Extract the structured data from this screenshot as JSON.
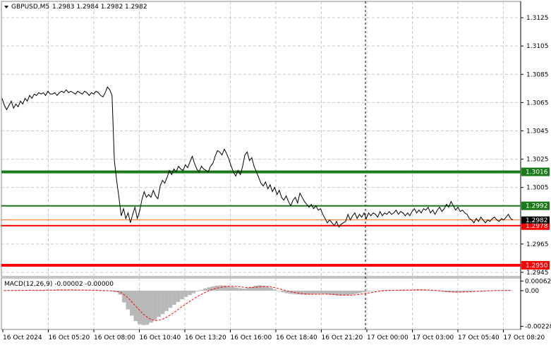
{
  "header": {
    "symbol_label": "GBPUSD,M5",
    "ohlc": "1.2983 1.2984 1.2982 1.2982"
  },
  "macd_label": "MACD(12,26,9) -0.00002 -0.00000",
  "colors": {
    "price_line": "#000000",
    "grid": "#c8c8c8",
    "level_green": "#1a7a1a",
    "level_red": "#ff0000",
    "current_price": "#ff6600",
    "macd_hist": "#b8b8b8",
    "macd_signal": "#ff0000",
    "tag_dark": "#000000"
  },
  "chart_data": {
    "type": "line",
    "title": "GBPUSD,M5",
    "y_ticks": [
      "1.3125",
      "1.3105",
      "1.3085",
      "1.3065",
      "1.3045",
      "1.3025",
      "1.3005",
      "1.2965",
      "1.2945"
    ],
    "ylim": [
      1.29425,
      1.3136
    ],
    "x_ticks": [
      "16 Oct 2024",
      "16 Oct 05:20",
      "16 Oct 08:00",
      "16 Oct 10:40",
      "16 Oct 13:20",
      "16 Oct 16:00",
      "16 Oct 18:40",
      "16 Oct 21:20",
      "17 Oct 00:00",
      "17 Oct 03:00",
      "17 Oct 05:40",
      "17 Oct 08:20"
    ],
    "levels": [
      {
        "price": 1.3016,
        "label": "1.3016",
        "color": "green",
        "weight": "thick"
      },
      {
        "price": 1.2992,
        "label": "1.2992",
        "color": "green",
        "weight": "thin"
      },
      {
        "price": 1.2978,
        "label": "1.2978",
        "color": "red",
        "weight": "thin"
      },
      {
        "price": 1.295,
        "label": "1.2950",
        "color": "red",
        "weight": "thick"
      }
    ],
    "current_price": {
      "value": 1.2982,
      "label": "1.2982"
    },
    "series": [
      {
        "values": [
          1.3068,
          1.3063,
          1.306,
          1.3063,
          1.3066,
          1.3061,
          1.3064,
          1.3062,
          1.3066,
          1.3064,
          1.3068,
          1.3066,
          1.307,
          1.3068,
          1.3071,
          1.307,
          1.3072,
          1.3071,
          1.3072,
          1.307,
          1.3073,
          1.3071,
          1.3071,
          1.3072,
          1.307,
          1.3072,
          1.3073,
          1.3072,
          1.3074,
          1.3072,
          1.3073,
          1.3072,
          1.3071,
          1.3073,
          1.3072,
          1.3071,
          1.3073,
          1.3072,
          1.307,
          1.3072,
          1.3071,
          1.3073,
          1.3072,
          1.307,
          1.3069,
          1.3072,
          1.3076,
          1.3074,
          1.307,
          1.3024,
          1.301,
          1.2998,
          1.2985,
          1.299,
          1.2983,
          1.2987,
          1.298,
          1.2986,
          1.2991,
          1.2983,
          1.2988,
          1.2996,
          1.3002,
          1.2998,
          1.3,
          1.2998,
          1.3003,
          1.2999,
          1.2997,
          1.3006,
          1.301,
          1.3008,
          1.3012,
          1.3017,
          1.3014,
          1.3018,
          1.3016,
          1.302,
          1.3018,
          1.3017,
          1.3021,
          1.3019,
          1.3023,
          1.3027,
          1.3022,
          1.3018,
          1.3016,
          1.302,
          1.3018,
          1.3017,
          1.3016,
          1.302,
          1.3022,
          1.3027,
          1.3031,
          1.303,
          1.3028,
          1.3032,
          1.3029,
          1.3025,
          1.302,
          1.3016,
          1.3013,
          1.3017,
          1.3014,
          1.302,
          1.3028,
          1.303,
          1.3024,
          1.3026,
          1.302,
          1.3016,
          1.3012,
          1.3008,
          1.3006,
          1.3009,
          1.3004,
          1.3007,
          1.3002,
          1.3005,
          1.3,
          1.3003,
          1.2998,
          1.2996,
          1.2999,
          1.2995,
          1.2992,
          1.2996,
          1.2998,
          1.2994,
          1.3001,
          1.2998,
          1.2995,
          1.2993,
          1.2991,
          1.2993,
          1.299,
          1.2992,
          1.2989,
          1.299,
          1.2986,
          1.2983,
          1.298,
          1.2982,
          1.298,
          1.2978,
          1.2981,
          1.2977,
          1.2979,
          1.298,
          1.2981,
          1.2986,
          1.2982,
          1.2985,
          1.2987,
          1.2983,
          1.2986,
          1.2984,
          1.2987,
          1.2983,
          1.2987,
          1.2985,
          1.2987,
          1.2986,
          1.2984,
          1.2988,
          1.2985,
          1.2987,
          1.2986,
          1.2988,
          1.2986,
          1.2987,
          1.2989,
          1.2986,
          1.2988,
          1.2987,
          1.2985,
          1.2987,
          1.2985,
          1.2988,
          1.299,
          1.2987,
          1.2989,
          1.2987,
          1.299,
          1.2989,
          1.2991,
          1.2987,
          1.2989,
          1.2986,
          1.2989,
          1.2991,
          1.2988,
          1.299,
          1.2993,
          1.2991,
          1.2995,
          1.2992,
          1.2989,
          1.2991,
          1.2988,
          1.2989,
          1.2987,
          1.2986,
          1.2983,
          1.2982,
          1.298,
          1.2983,
          1.2981,
          1.2984,
          1.2982,
          1.298,
          1.2982,
          1.2981,
          1.2983,
          1.2984,
          1.2982,
          1.2981,
          1.2983,
          1.2982,
          1.2984,
          1.2986,
          1.2983,
          1.2982
        ]
      }
    ]
  },
  "macd": {
    "y_ticks": [
      "0.00062",
      "0.00",
      "-0.00228"
    ],
    "ylim": [
      -0.00235,
      0.00068
    ],
    "histogram": [
      2e-05,
      3e-05,
      1e-05,
      2e-05,
      3e-05,
      2e-05,
      4e-05,
      3e-05,
      4e-05,
      3e-05,
      4e-05,
      5e-05,
      4e-05,
      5e-05,
      6e-05,
      5e-05,
      6e-05,
      5e-05,
      4e-05,
      5e-05,
      4e-05,
      3e-05,
      4e-05,
      3e-05,
      2e-05,
      1e-05,
      0.0,
      -2e-05,
      -4e-05,
      -8e-05,
      -0.00025,
      -0.00075,
      -0.0012,
      -0.0016,
      -0.00195,
      -0.00215,
      -0.0022,
      -0.00218,
      -0.00205,
      -0.00188,
      -0.00168,
      -0.0015,
      -0.0013,
      -0.0011,
      -0.0009,
      -0.00072,
      -0.00055,
      -0.0004,
      -0.00028,
      -0.00016,
      -4e-05,
      6e-05,
      0.00015,
      0.00022,
      0.00028,
      0.00032,
      0.00034,
      0.00033,
      0.0003,
      0.00025,
      0.0002,
      0.00016,
      0.00014,
      0.00018,
      0.00025,
      0.00032,
      0.00035,
      0.00032,
      0.00026,
      0.00018,
      8e-05,
      -2e-05,
      -0.0001,
      -0.00016,
      -0.0002,
      -0.00022,
      -0.00024,
      -0.00025,
      -0.00026,
      -0.00025,
      -0.00022,
      -0.0002,
      -0.00018,
      -0.0002,
      -0.00024,
      -0.00028,
      -0.0003,
      -0.00031,
      -0.0003,
      -0.00028,
      -0.00025,
      -0.0002,
      -0.00015,
      -0.0001,
      -5e-05,
      -2e-05,
      1e-05,
      3e-05,
      4e-05,
      5e-05,
      4e-05,
      3e-05,
      5e-05,
      6e-05,
      5e-05,
      4e-05,
      6e-05,
      8e-05,
      7e-05,
      5e-05,
      3e-05,
      2e-05,
      -2e-05,
      -5e-05,
      -8e-05,
      -0.0001,
      -0.00011,
      -0.00012,
      -0.0001,
      -8e-05,
      -6e-05,
      -4e-05,
      -3e-05,
      -2e-05,
      -1e-05,
      0.0,
      1e-05,
      2e-05,
      1e-05,
      2e-05,
      3e-05,
      2e-05
    ],
    "signal": [
      1e-05,
      2e-05,
      2e-05,
      2e-05,
      2e-05,
      2e-05,
      3e-05,
      3e-05,
      3e-05,
      3e-05,
      3e-05,
      4e-05,
      4e-05,
      4e-05,
      5e-05,
      5e-05,
      5e-05,
      5e-05,
      5e-05,
      5e-05,
      4e-05,
      4e-05,
      4e-05,
      3e-05,
      3e-05,
      2e-05,
      1e-05,
      0.0,
      -2e-05,
      -4e-05,
      -0.0001,
      -0.00025,
      -0.00045,
      -0.0007,
      -0.00098,
      -0.00125,
      -0.0015,
      -0.0017,
      -0.00185,
      -0.00192,
      -0.0019,
      -0.00182,
      -0.0017,
      -0.00155,
      -0.00138,
      -0.0012,
      -0.00102,
      -0.00085,
      -0.00068,
      -0.00052,
      -0.00037,
      -0.00023,
      -0.00011,
      0.0,
      9e-05,
      0.00016,
      0.00022,
      0.00026,
      0.00028,
      0.00028,
      0.00027,
      0.00025,
      0.00022,
      0.0002,
      0.0002,
      0.00022,
      0.00025,
      0.00027,
      0.00027,
      0.00024,
      0.00019,
      0.00013,
      6e-05,
      0.0,
      -6e-05,
      -0.00011,
      -0.00015,
      -0.00018,
      -0.00021,
      -0.00023,
      -0.00023,
      -0.00023,
      -0.00022,
      -0.00022,
      -0.00023,
      -0.00024,
      -0.00026,
      -0.00028,
      -0.00029,
      -0.00029,
      -0.00028,
      -0.00026,
      -0.00023,
      -0.00019,
      -0.00015,
      -0.00011,
      -7e-05,
      -4e-05,
      -1e-05,
      1e-05,
      2e-05,
      3e-05,
      3e-05,
      4e-05,
      4e-05,
      4e-05,
      5e-05,
      6e-05,
      6e-05,
      5e-05,
      4e-05,
      3e-05,
      1e-05,
      -1e-05,
      -4e-05,
      -6e-05,
      -8e-05,
      -9e-05,
      -9e-05,
      -8e-05,
      -7e-05,
      -6e-05,
      -4e-05,
      -3e-05,
      -2e-05,
      -1e-05,
      0.0,
      1e-05,
      1e-05,
      1e-05,
      2e-05,
      2e-05
    ]
  }
}
